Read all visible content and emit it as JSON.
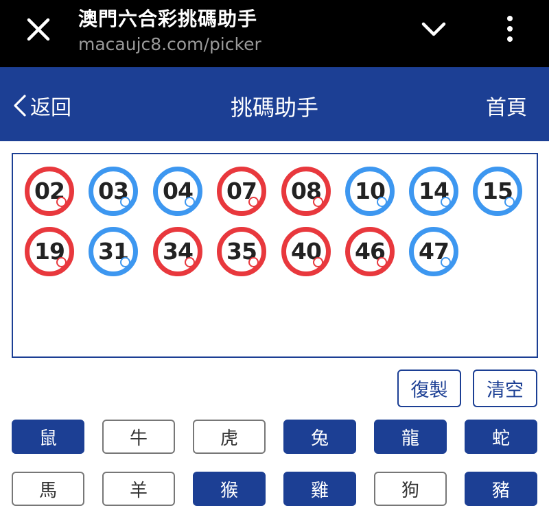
{
  "browser": {
    "title": "澳門六合彩挑碼助手",
    "url": "macaujc8.com/picker"
  },
  "header": {
    "back_label": "返回",
    "title": "挑碼助手",
    "home_label": "首頁"
  },
  "balls": [
    {
      "num": "02",
      "color": "red"
    },
    {
      "num": "03",
      "color": "blue"
    },
    {
      "num": "04",
      "color": "blue"
    },
    {
      "num": "07",
      "color": "red"
    },
    {
      "num": "08",
      "color": "red"
    },
    {
      "num": "10",
      "color": "blue"
    },
    {
      "num": "14",
      "color": "blue"
    },
    {
      "num": "15",
      "color": "blue"
    },
    {
      "num": "19",
      "color": "red"
    },
    {
      "num": "31",
      "color": "blue"
    },
    {
      "num": "34",
      "color": "red"
    },
    {
      "num": "35",
      "color": "red"
    },
    {
      "num": "40",
      "color": "red"
    },
    {
      "num": "46",
      "color": "red"
    },
    {
      "num": "47",
      "color": "blue"
    }
  ],
  "actions": {
    "copy_label": "復製",
    "clear_label": "清空"
  },
  "zodiacs": [
    {
      "label": "鼠",
      "selected": true
    },
    {
      "label": "牛",
      "selected": false
    },
    {
      "label": "虎",
      "selected": false
    },
    {
      "label": "兔",
      "selected": true
    },
    {
      "label": "龍",
      "selected": true
    },
    {
      "label": "蛇",
      "selected": true
    },
    {
      "label": "馬",
      "selected": false
    },
    {
      "label": "羊",
      "selected": false
    },
    {
      "label": "猴",
      "selected": true
    },
    {
      "label": "雞",
      "selected": true
    },
    {
      "label": "狗",
      "selected": false
    },
    {
      "label": "豬",
      "selected": true
    }
  ],
  "colors": {
    "brand": "#1c3f94",
    "red_ball": "#e8383d",
    "blue_ball": "#3d97f0"
  }
}
